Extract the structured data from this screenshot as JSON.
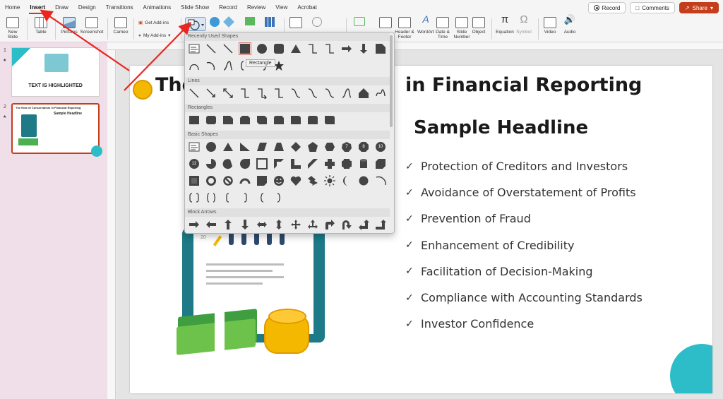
{
  "menu": {
    "tabs": [
      "Home",
      "Insert",
      "Draw",
      "Design",
      "Transitions",
      "Animations",
      "Slide Show",
      "Record",
      "Review",
      "View",
      "Acrobat"
    ],
    "active_tab": "Insert",
    "record_label": "Record",
    "comments_label": "Comments",
    "share_label": "Share"
  },
  "ribbon": {
    "new_slide": "New Slide",
    "table": "Table",
    "pictures": "Pictures",
    "screenshot": "Screenshot",
    "cameo": "Cameo",
    "get_addins": "Get Add-ins",
    "my_addins": "My Add-ins",
    "header_footer": "Header & Footer",
    "wordart": "WordArt",
    "date_time": "Date & Time",
    "slide_number": "Slide Number",
    "object": "Object",
    "equation": "Equation",
    "symbol": "Symbol",
    "video": "Video",
    "audio": "Audio"
  },
  "thumbnails": [
    {
      "number": "1",
      "caption": "TEXT IS HIGHLIGHTED"
    },
    {
      "number": "2",
      "title": "The Role of Conservatism in Financial Reporting",
      "headline": "Sample Headline"
    }
  ],
  "slide": {
    "title_left": "The",
    "title_right": "in Financial Reporting",
    "headline": "Sample Headline",
    "bullets": [
      "Protection of Creditors and Investors",
      "Avoidance of Overstatement of Profits",
      "Prevention of Fraud",
      "Enhancement of Credibility",
      "Facilitation of Decision-Making",
      "Compliance with Accounting Standards",
      "Investor Confidence"
    ],
    "chart_tick_20": "20"
  },
  "gallery": {
    "sections": [
      "Recently Used Shapes",
      "Lines",
      "Rectangles",
      "Basic Shapes",
      "Block Arrows"
    ],
    "tooltip": "Rectangle",
    "badges": [
      "7",
      "8",
      "10",
      "12"
    ]
  },
  "colors": {
    "accent": "#c43e1c",
    "teal": "#2dbdc8",
    "arrow": "#e8261f"
  }
}
